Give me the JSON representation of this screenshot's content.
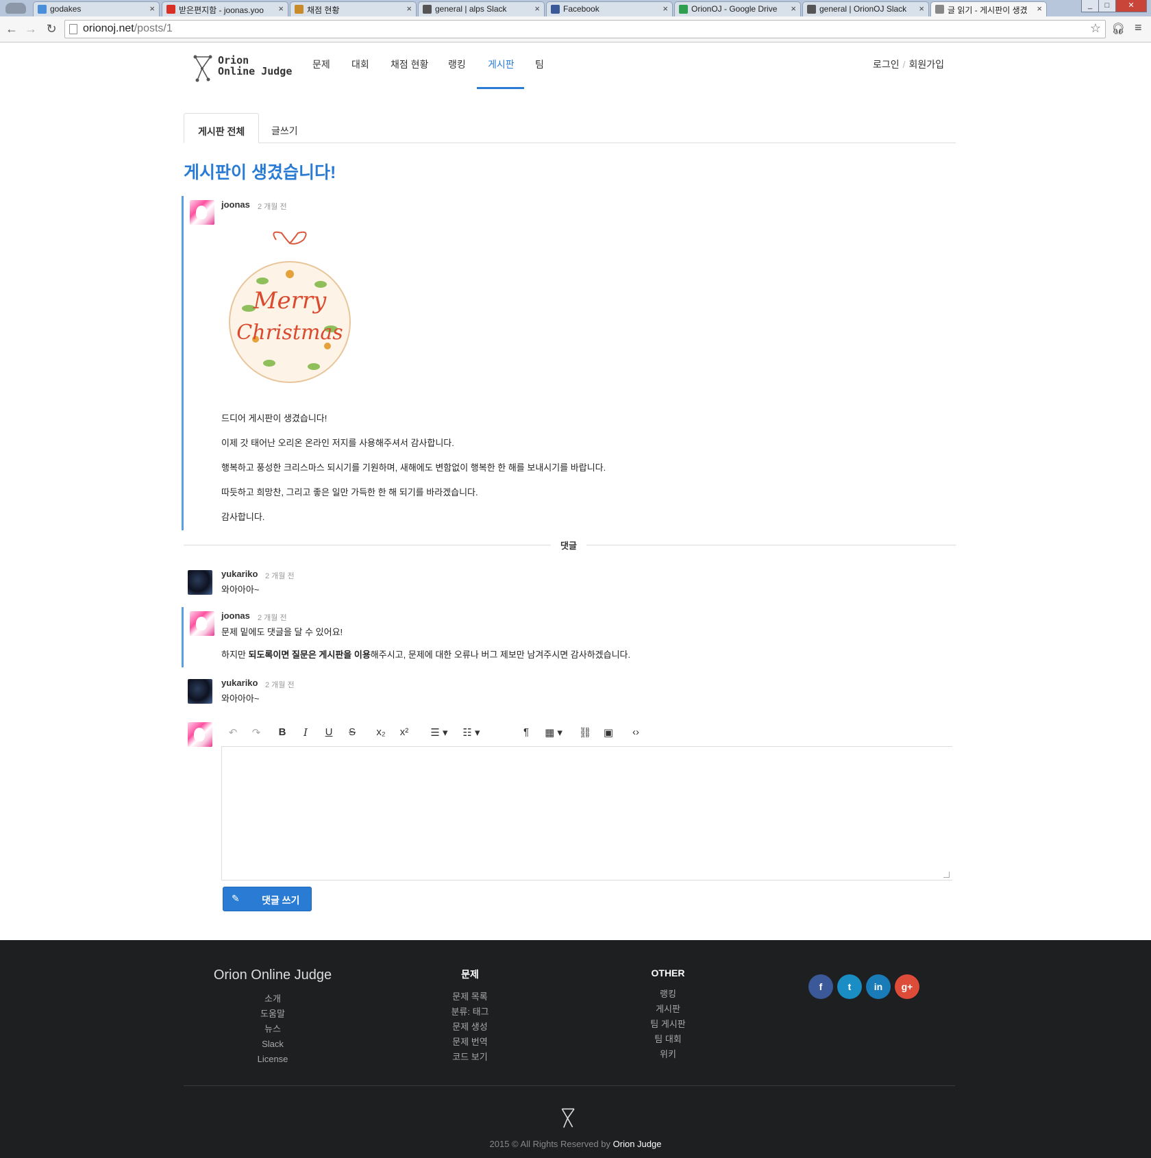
{
  "browser": {
    "tabs": [
      {
        "title": "godakes",
        "icon": "feedly-icon",
        "color": "#4a8fd9"
      },
      {
        "title": "받은편지함 - joonas.yoo",
        "icon": "gmail-icon",
        "color": "#d93025"
      },
      {
        "title": "채점 현황",
        "icon": "orionoj-icon",
        "color": "#c98b2a"
      },
      {
        "title": "general | alps Slack",
        "icon": "slack-icon",
        "color": "#555"
      },
      {
        "title": "Facebook",
        "icon": "facebook-icon",
        "color": "#3b5998"
      },
      {
        "title": "OrionOJ - Google Drive",
        "icon": "drive-icon",
        "color": "#2e9e4f"
      },
      {
        "title": "general | OrionOJ Slack",
        "icon": "slack-icon",
        "color": "#555"
      },
      {
        "title": "글 읽기 - 게시판이 생겼",
        "icon": "page-icon",
        "color": "#888"
      }
    ],
    "url_host": "orionoj.net",
    "url_path": "/posts/1"
  },
  "site": {
    "logo_line1": "Orion",
    "logo_line2": "Online Judge",
    "nav": [
      "문제",
      "대회",
      "채점 현황",
      "랭킹",
      "게시판",
      "팀"
    ],
    "active_nav": "게시판",
    "login": "로그인",
    "signup": "회원가입"
  },
  "board_tabs": {
    "all": "게시판 전체",
    "write": "글쓰기"
  },
  "post": {
    "title": "게시판이 생겼습니다!",
    "author": "joonas",
    "time": "2 개월 전",
    "image_alt": "Merry Christmas",
    "paragraphs": [
      "드디어 게시판이 생겼습니다!",
      "이제 갓 태어난 오리온 온라인 저지를 사용해주셔서 감사합니다.",
      "행복하고 풍성한 크리스마스 되시기를 기원하며, 새해에도 변함없이 행복한 한 해를 보내시기를 바랍니다.",
      "따듯하고 희망찬, 그리고 좋은 일만 가득한 한 해 되기를 바라겠습니다.",
      "감사합니다."
    ]
  },
  "comments_label": "댓글",
  "comments": [
    {
      "author": "yukariko",
      "time": "2 개월 전",
      "lines": [
        "와아아아~"
      ]
    },
    {
      "author": "joonas",
      "time": "2 개월 전",
      "line1": "문제 밑에도 댓글을 달 수 있어요!",
      "line2_a": "하지만 ",
      "line2_b": "되도록이면 질문은 게시판을 이용",
      "line2_c": "해주시고, 문제에 대한 오류나 버그 제보만 남겨주시면 감사하겠습니다."
    },
    {
      "author": "yukariko",
      "time": "2 개월 전",
      "lines": [
        "와아아아~"
      ]
    }
  ],
  "editor": {
    "tools": [
      "undo-icon",
      "redo-icon",
      "bold-icon",
      "italic-icon",
      "underline-icon",
      "strikethrough-icon",
      "subscript-icon",
      "superscript-icon",
      "bullet-list-icon",
      "numbered-list-icon",
      "paragraph-icon",
      "table-icon",
      "link-icon",
      "image-icon",
      "code-view-icon"
    ],
    "submit_label": "댓글 쓰기"
  },
  "footer": {
    "brand": "Orion Online Judge",
    "col1": [
      "소개",
      "도움말",
      "뉴스",
      "Slack",
      "License"
    ],
    "col2_title": "문제",
    "col2": [
      "문제 목록",
      "분류: 태그",
      "문제 생성",
      "문제 번역",
      "코드 보기"
    ],
    "col3_title": "OTHER",
    "col3": [
      "랭킹",
      "게시판",
      "팀 게시판",
      "팀 대회",
      "위키"
    ],
    "social": [
      {
        "icon": "facebook-icon",
        "glyph": "f",
        "color": "#3b5998"
      },
      {
        "icon": "twitter-icon",
        "glyph": "t",
        "color": "#1a8dc4"
      },
      {
        "icon": "linkedin-icon",
        "glyph": "in",
        "color": "#1a7bb9"
      },
      {
        "icon": "google-plus-icon",
        "glyph": "g+",
        "color": "#dd4b39"
      }
    ],
    "copyright_prefix": "2015 © All Rights Reserved by ",
    "copyright_brand": "Orion Judge"
  }
}
